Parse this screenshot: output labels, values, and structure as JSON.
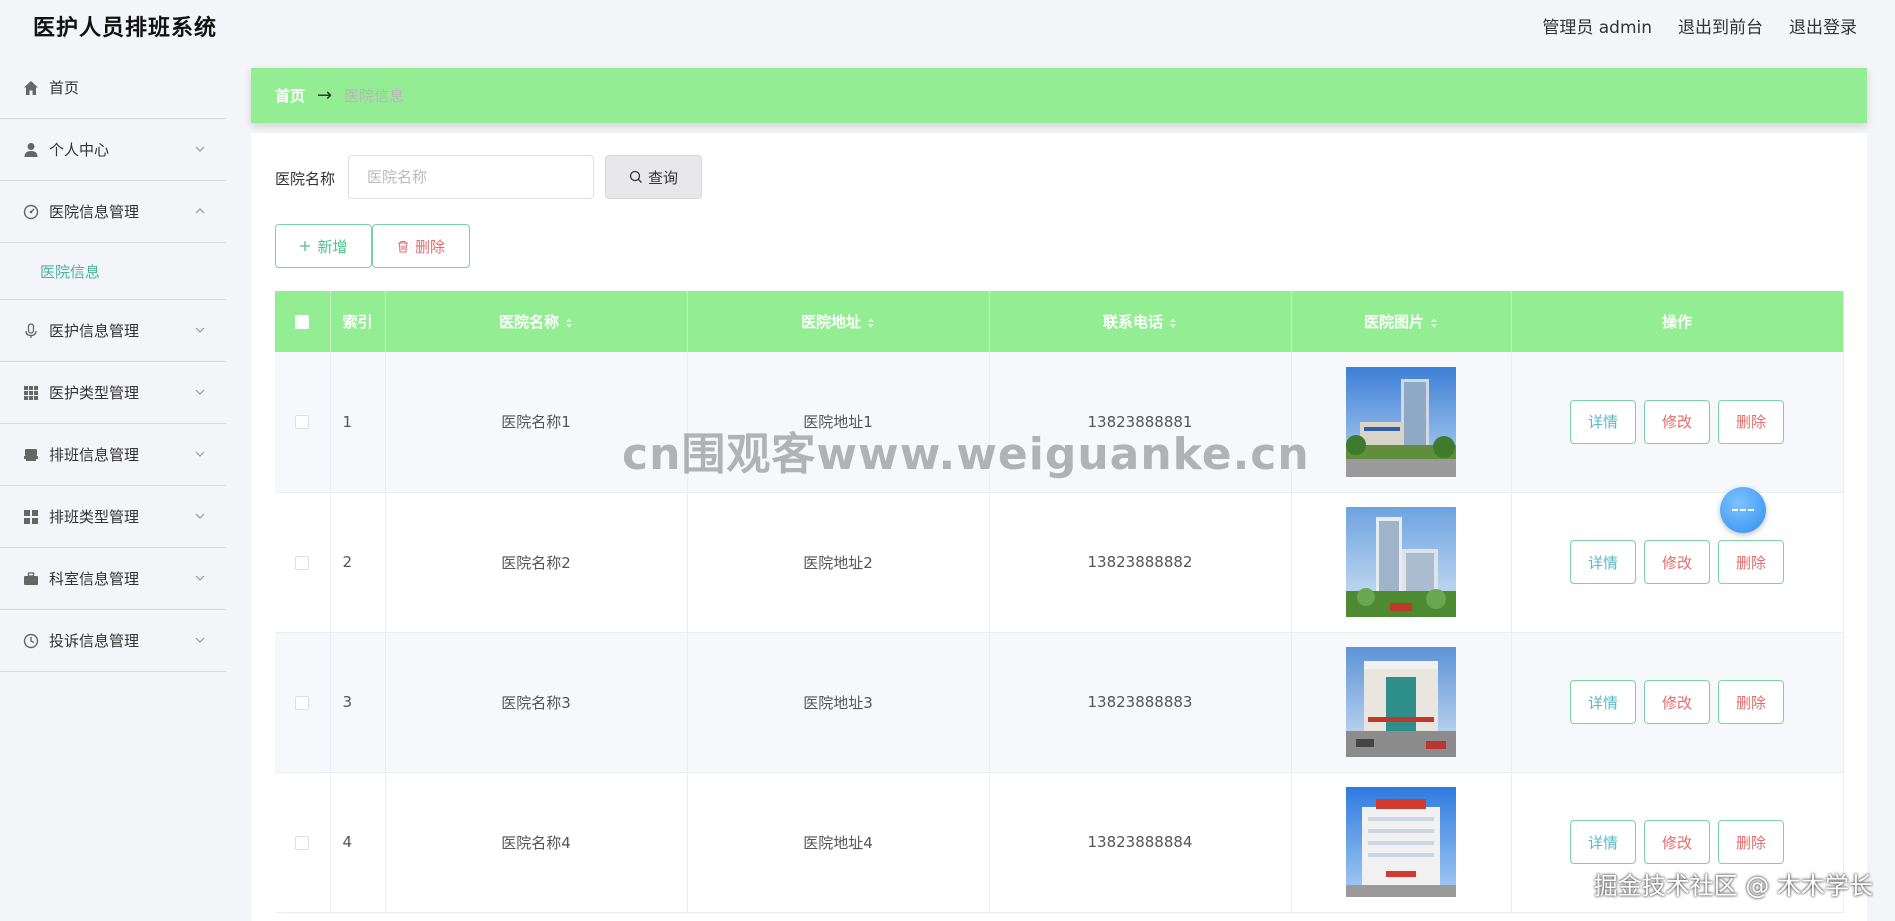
{
  "app": {
    "title": "医护人员排班系统"
  },
  "top_links": {
    "admin": "管理员 admin",
    "front": "退出到前台",
    "logout": "退出登录"
  },
  "sidebar": {
    "items": [
      {
        "label": "首页",
        "icon": "home-icon"
      },
      {
        "label": "个人中心",
        "icon": "user-icon"
      },
      {
        "label": "医院信息管理",
        "icon": "dashboard-icon",
        "expanded": true,
        "sub": [
          {
            "label": "医院信息"
          }
        ]
      },
      {
        "label": "医护信息管理",
        "icon": "microphone-icon"
      },
      {
        "label": "医护类型管理",
        "icon": "grid-icon"
      },
      {
        "label": "排班信息管理",
        "icon": "printer-icon"
      },
      {
        "label": "排班类型管理",
        "icon": "apps-icon"
      },
      {
        "label": "科室信息管理",
        "icon": "briefcase-icon"
      },
      {
        "label": "投诉信息管理",
        "icon": "clock-icon"
      }
    ]
  },
  "breadcrumb": {
    "home": "首页",
    "arrow": "→",
    "current": "医院信息"
  },
  "search": {
    "label": "医院名称",
    "placeholder": "医院名称",
    "value": "",
    "button": "查询"
  },
  "actions": {
    "add": "新增",
    "delete": "删除"
  },
  "table": {
    "columns": [
      "索引",
      "医院名称",
      "医院地址",
      "联系电话",
      "医院图片",
      "操作"
    ],
    "rows": [
      {
        "index": "1",
        "name": "医院名称1",
        "address": "医院地址1",
        "phone": "13823888881"
      },
      {
        "index": "2",
        "name": "医院名称2",
        "address": "医院地址2",
        "phone": "13823888882"
      },
      {
        "index": "3",
        "name": "医院名称3",
        "address": "医院地址3",
        "phone": "13823888883"
      },
      {
        "index": "4",
        "name": "医院名称4",
        "address": "医院地址4",
        "phone": "13823888884"
      }
    ],
    "row_actions": {
      "detail": "详情",
      "edit": "修改",
      "delete": "删除"
    }
  },
  "watermarks": {
    "center": "cn围观客www.weiguanke.cn",
    "corner": "掘金技术社区 @ 木木学长"
  },
  "colors": {
    "accent_green": "#93ee93",
    "button_border": "#7bd3a2",
    "danger": "#e36c6c",
    "info": "#5bb8c4"
  }
}
